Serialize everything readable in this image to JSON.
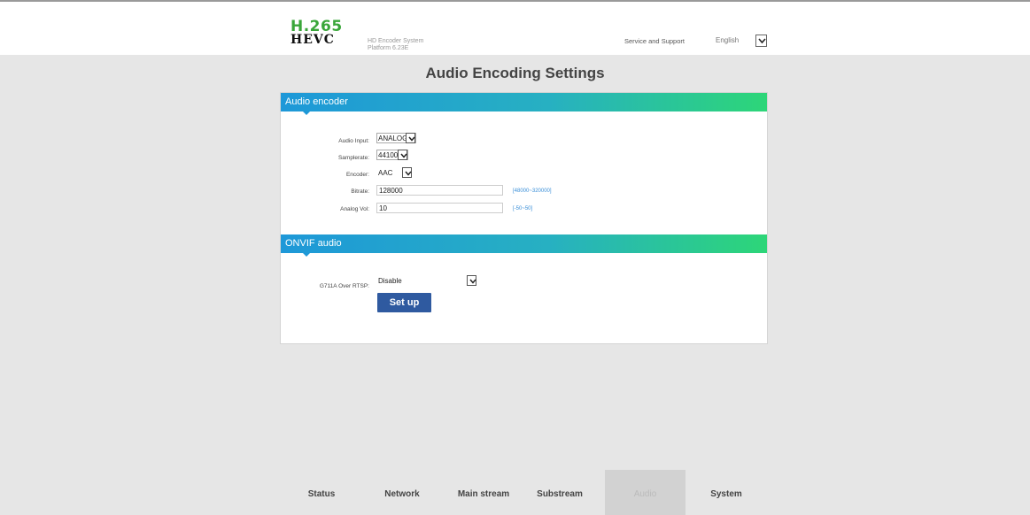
{
  "header": {
    "logo_line1": "H.265",
    "logo_line2": "HEVC",
    "system_name": "HD Encoder System",
    "platform": "Platform 6.23E",
    "service_link": "Service and Support",
    "language": "English"
  },
  "page_title": "Audio Encoding Settings",
  "audio_encoder": {
    "heading": "Audio encoder",
    "audio_input": {
      "label": "Audio Input:",
      "value": "ANALOG"
    },
    "samplerate": {
      "label": "Samplerate:",
      "value": "44100"
    },
    "encoder": {
      "label": "Encoder:",
      "value": "AAC"
    },
    "bitrate": {
      "label": "Bitrate:",
      "value": "128000",
      "range": "[48000~320000]"
    },
    "analog_vol": {
      "label": "Analog Vol:",
      "value": "10",
      "range": "[-50~50]"
    }
  },
  "onvif_audio": {
    "heading": "ONVIF audio",
    "g711a": {
      "label": "G711A Over RTSP:",
      "value": "Disable"
    },
    "setup_label": "Set up"
  },
  "nav": {
    "items": [
      {
        "label": "Status"
      },
      {
        "label": "Network"
      },
      {
        "label": "Main stream"
      },
      {
        "label": "Substream"
      },
      {
        "label": "Audio"
      },
      {
        "label": "System"
      }
    ],
    "active": "Audio"
  },
  "colors": {
    "header_gradient_start": "#1e98d8",
    "header_gradient_end": "#2dd678",
    "button": "#2f5aa0",
    "hint": "#3a8fd8",
    "logo_green": "#3aa63a"
  }
}
